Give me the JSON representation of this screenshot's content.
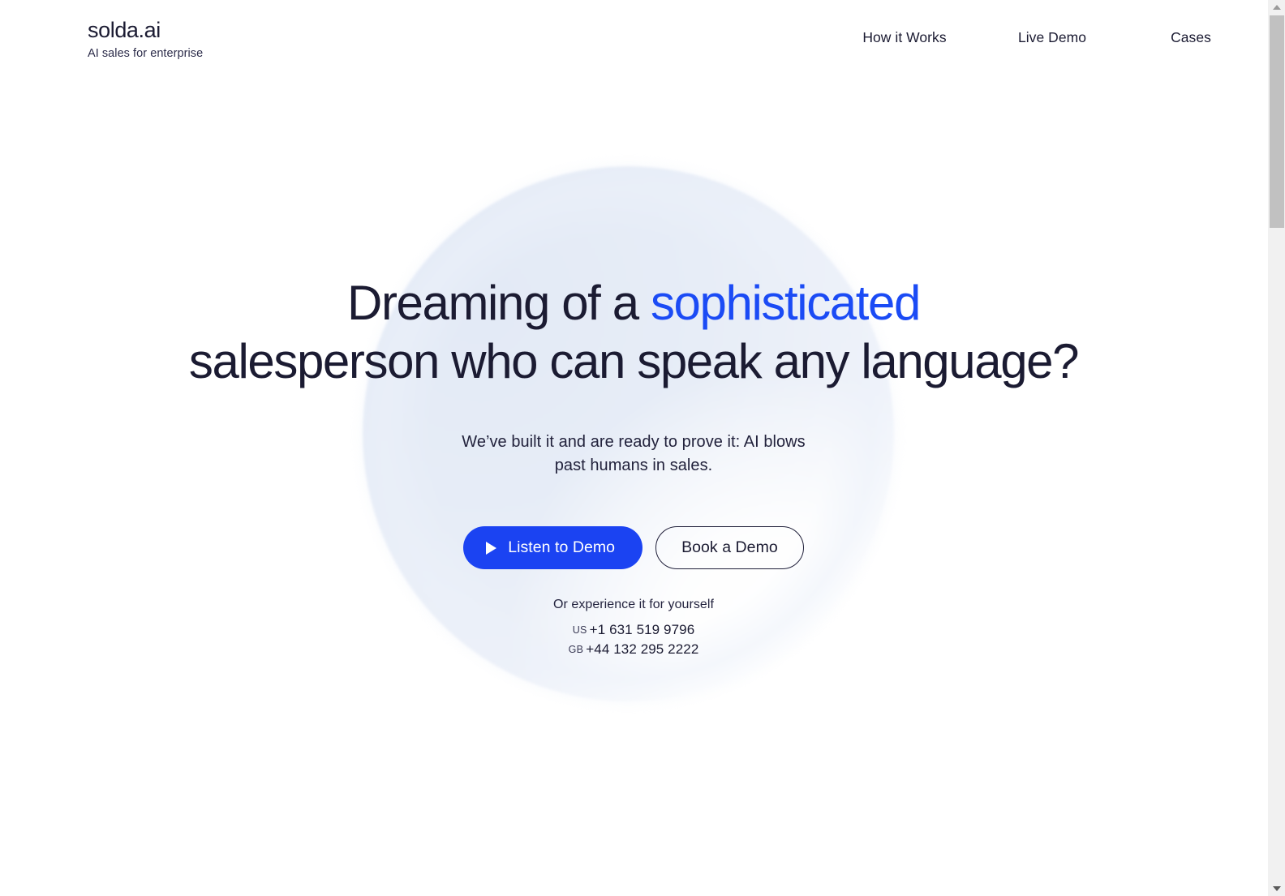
{
  "header": {
    "brand_name": "solda.ai",
    "brand_tagline": "AI sales for enterprise",
    "nav": [
      {
        "label": "How it Works"
      },
      {
        "label": "Live Demo"
      },
      {
        "label": "Cases"
      }
    ]
  },
  "hero": {
    "title_line1_plain": "Dreaming of a ",
    "title_line1_accent": "sophisticated",
    "title_line2": "salesperson who can speak any language?",
    "subtitle_line1": "We’ve built it and are ready to prove it: AI blows",
    "subtitle_line2": "past humans in sales.",
    "primary_button": "Listen to Demo",
    "primary_button_icon": "play-icon",
    "secondary_button": "Book a Demo",
    "phones_label": "Or experience it for yourself",
    "phones": [
      {
        "country": "US",
        "number": "+1 631 519 9796"
      },
      {
        "country": "GB",
        "number": "+44 132 295 2222"
      }
    ]
  },
  "colors": {
    "accent_blue": "#1b4bf5",
    "button_blue": "#1b43f2",
    "text_dark": "#1b1b32",
    "blob_tint": "#e6ecf6",
    "page_background": "#ffffff"
  },
  "scrollbar": {
    "up_arrow_icon": "chevron-up-icon",
    "down_arrow_icon": "chevron-down-icon"
  }
}
